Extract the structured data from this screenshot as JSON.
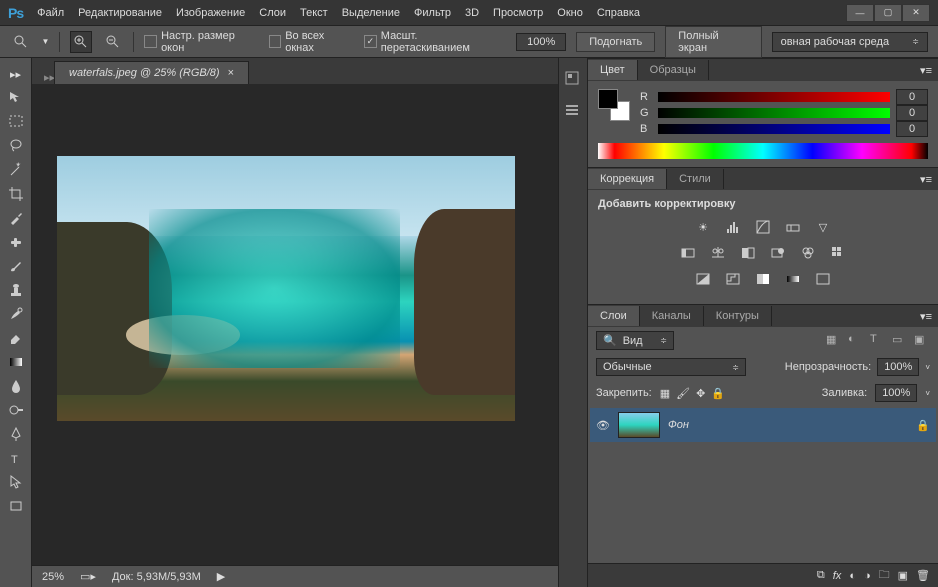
{
  "app": {
    "logo": "Ps"
  },
  "menu": [
    "Файл",
    "Редактирование",
    "Изображение",
    "Слои",
    "Текст",
    "Выделение",
    "Фильтр",
    "3D",
    "Просмотр",
    "Окно",
    "Справка"
  ],
  "options": {
    "resize_windows": "Настр. размер окон",
    "all_windows": "Во всех окнах",
    "scrubby_zoom": "Масшт. перетаскиванием",
    "zoom": "100%",
    "fit": "Подогнать",
    "fullscreen": "Полный экран",
    "workspace": "овная рабочая среда"
  },
  "doc": {
    "tab": "waterfals.jpeg @ 25% (RGB/8)"
  },
  "status": {
    "zoom": "25%",
    "docsize_label": "Док:",
    "docsize": "5,93M/5,93M"
  },
  "color_panel": {
    "tab1": "Цвет",
    "tab2": "Образцы",
    "r": "R",
    "g": "G",
    "b": "B",
    "rv": "0",
    "gv": "0",
    "bv": "0"
  },
  "adjust_panel": {
    "tab1": "Коррекция",
    "tab2": "Стили",
    "title": "Добавить корректировку"
  },
  "layers_panel": {
    "tab1": "Слои",
    "tab2": "Каналы",
    "tab3": "Контуры",
    "search": "Вид",
    "blend": "Обычные",
    "opacity_label": "Непрозрачность:",
    "opacity": "100%",
    "lock_label": "Закрепить:",
    "fill_label": "Заливка:",
    "fill": "100%",
    "layer_name": "Фон"
  }
}
